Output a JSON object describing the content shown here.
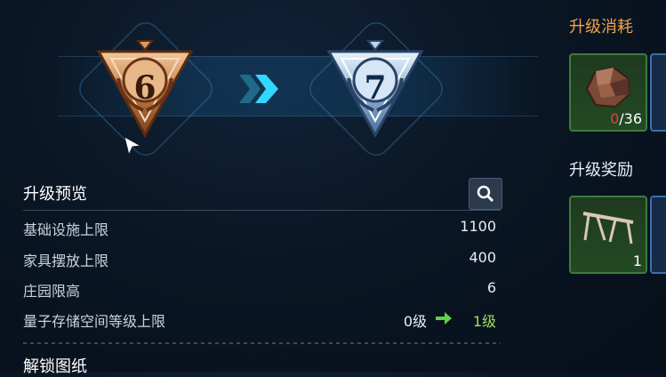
{
  "upgrade": {
    "from_level": "6",
    "to_level": "7"
  },
  "preview": {
    "title": "升级预览",
    "rows": [
      {
        "label": "基础设施上限",
        "value": "1100"
      },
      {
        "label": "家具摆放上限",
        "value": "400"
      },
      {
        "label": "庄园限高",
        "value": "6"
      },
      {
        "label": "量子存储空间等级上限",
        "from": "0级",
        "to": "1级"
      }
    ]
  },
  "blueprint": {
    "title": "解锁图纸"
  },
  "cost": {
    "title": "升级消耗",
    "item": {
      "icon": "ore-icon",
      "have": "0",
      "need": "/36"
    }
  },
  "reward": {
    "title": "升级奖励",
    "item": {
      "icon": "rack-icon",
      "count": "1"
    }
  },
  "colors": {
    "cost_title": "#f0a24a",
    "insufficient": "#e04040",
    "level_up": "#9fe05a",
    "chevron": "#33d6ff"
  }
}
